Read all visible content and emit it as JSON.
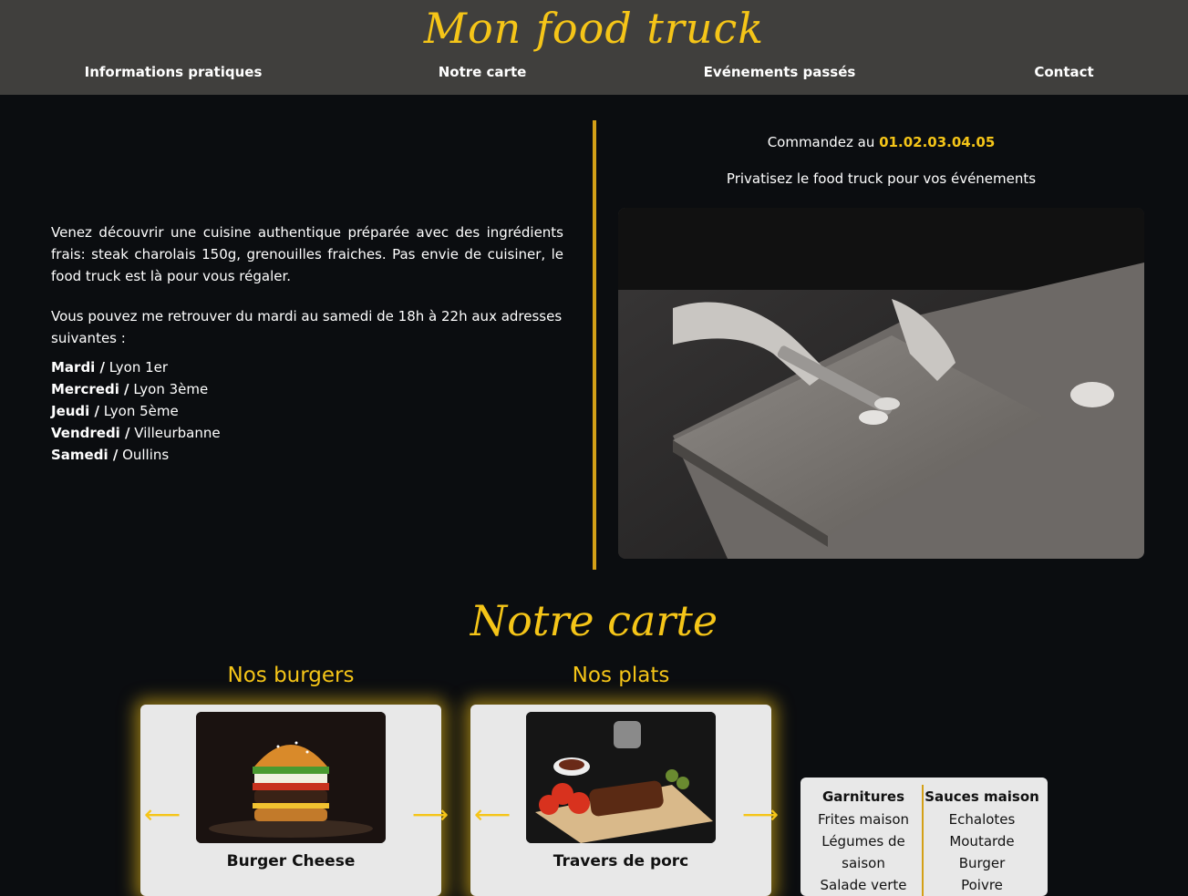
{
  "header": {
    "title": "Mon food truck",
    "nav": [
      {
        "label": "Informations pratiques"
      },
      {
        "label": "Notre carte"
      },
      {
        "label": "Evénements passés"
      },
      {
        "label": "Contact"
      }
    ]
  },
  "about": {
    "intro": "Venez découvrir une cuisine authentique préparée avec des ingrédients frais: steak charolais 150g, grenouilles fraiches. Pas envie de cuisiner, le food truck est là pour vous régaler.",
    "hours": "Vous pouvez me retrouver du mardi au samedi de 18h à 22h aux adresses suivantes :",
    "schedule": [
      {
        "day": "Mardi /",
        "place": " Lyon 1er"
      },
      {
        "day": "Mercredi /",
        "place": " Lyon 3ème"
      },
      {
        "day": "Jeudi /",
        "place": " Lyon 5ème"
      },
      {
        "day": "Vendredi /",
        "place": " Villeurbanne"
      },
      {
        "day": "Samedi /",
        "place": " Oullins"
      }
    ]
  },
  "contact": {
    "order_prefix": "Commandez au ",
    "phone": "01.02.03.04.05",
    "privatize": "Privatisez le food truck pour vos événements"
  },
  "menu": {
    "title": "Notre carte",
    "burgers": {
      "title": "Nos burgers",
      "item": "Burger Cheese"
    },
    "dishes": {
      "title": "Nos plats",
      "item": "Travers de porc"
    },
    "sides": {
      "garnish_title": "Garnitures",
      "garnish": [
        "Frites maison",
        "Légumes de saison",
        "Salade verte"
      ],
      "sauce_title": "Sauces maison",
      "sauces": [
        "Echalotes",
        "Moutarde",
        "Burger",
        "Poivre"
      ]
    },
    "accent_color": "#f5c518"
  }
}
